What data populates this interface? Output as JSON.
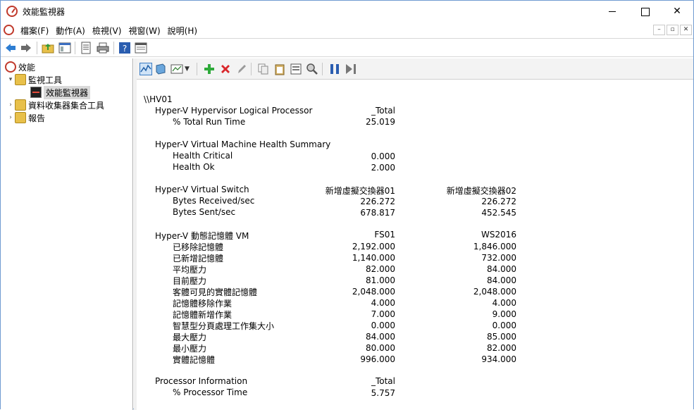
{
  "window": {
    "title": "效能監視器"
  },
  "menu": [
    "檔案(F)",
    "動作(A)",
    "檢視(V)",
    "視窗(W)",
    "說明(H)"
  ],
  "mdi": {
    "minimize": "–",
    "restore": "▫",
    "close": "✕"
  },
  "tree": {
    "root": "效能",
    "monitoring_tools": "監視工具",
    "perf_monitor": "效能監視器",
    "data_collector_sets": "資料收集器集合工具",
    "reports": "報告"
  },
  "report": {
    "host": "\\\\HV01",
    "sections": [
      {
        "object": "Hyper-V Hypervisor Logical Processor",
        "instances": [
          "_Total"
        ],
        "counters": [
          {
            "name": "% Total Run Time",
            "values": [
              "25.019"
            ]
          }
        ]
      },
      {
        "object": "Hyper-V Virtual Machine Health Summary",
        "instances": [],
        "counters": [
          {
            "name": "Health Critical",
            "values": [
              "0.000"
            ]
          },
          {
            "name": "Health Ok",
            "values": [
              "2.000"
            ]
          }
        ]
      },
      {
        "object": "Hyper-V Virtual Switch",
        "instances": [
          "新增虛擬交換器01",
          "新增虛擬交換器02"
        ],
        "counters": [
          {
            "name": "Bytes Received/sec",
            "values": [
              "226.272",
              "226.272"
            ]
          },
          {
            "name": "Bytes Sent/sec",
            "values": [
              "678.817",
              "452.545"
            ]
          }
        ]
      },
      {
        "object": "Hyper-V 動態記憶體 VM",
        "instances": [
          "FS01",
          "WS2016"
        ],
        "counters": [
          {
            "name": "已移除記憶體",
            "values": [
              "2,192.000",
              "1,846.000"
            ]
          },
          {
            "name": "已新增記憶體",
            "values": [
              "1,140.000",
              "732.000"
            ]
          },
          {
            "name": "平均壓力",
            "values": [
              "82.000",
              "84.000"
            ]
          },
          {
            "name": "目前壓力",
            "values": [
              "81.000",
              "84.000"
            ]
          },
          {
            "name": "客體可見的實體記憶體",
            "values": [
              "2,048.000",
              "2,048.000"
            ]
          },
          {
            "name": "記憶體移除作業",
            "values": [
              "4.000",
              "4.000"
            ]
          },
          {
            "name": "記憶體新增作業",
            "values": [
              "7.000",
              "9.000"
            ]
          },
          {
            "name": "智慧型分頁處理工作集大小",
            "values": [
              "0.000",
              "0.000"
            ]
          },
          {
            "name": "最大壓力",
            "values": [
              "84.000",
              "85.000"
            ]
          },
          {
            "name": "最小壓力",
            "values": [
              "80.000",
              "82.000"
            ]
          },
          {
            "name": "實體記憶體",
            "values": [
              "996.000",
              "934.000"
            ]
          }
        ]
      },
      {
        "object": "Processor Information",
        "instances": [
          "_Total"
        ],
        "counters": [
          {
            "name": "% Processor Time",
            "values": [
              "5.757"
            ]
          }
        ]
      }
    ]
  },
  "colors": {
    "accent_red": "#c0392b",
    "add_green": "#2eaa3a",
    "delete_red": "#d9262b",
    "pause_blue": "#2a5db0"
  }
}
